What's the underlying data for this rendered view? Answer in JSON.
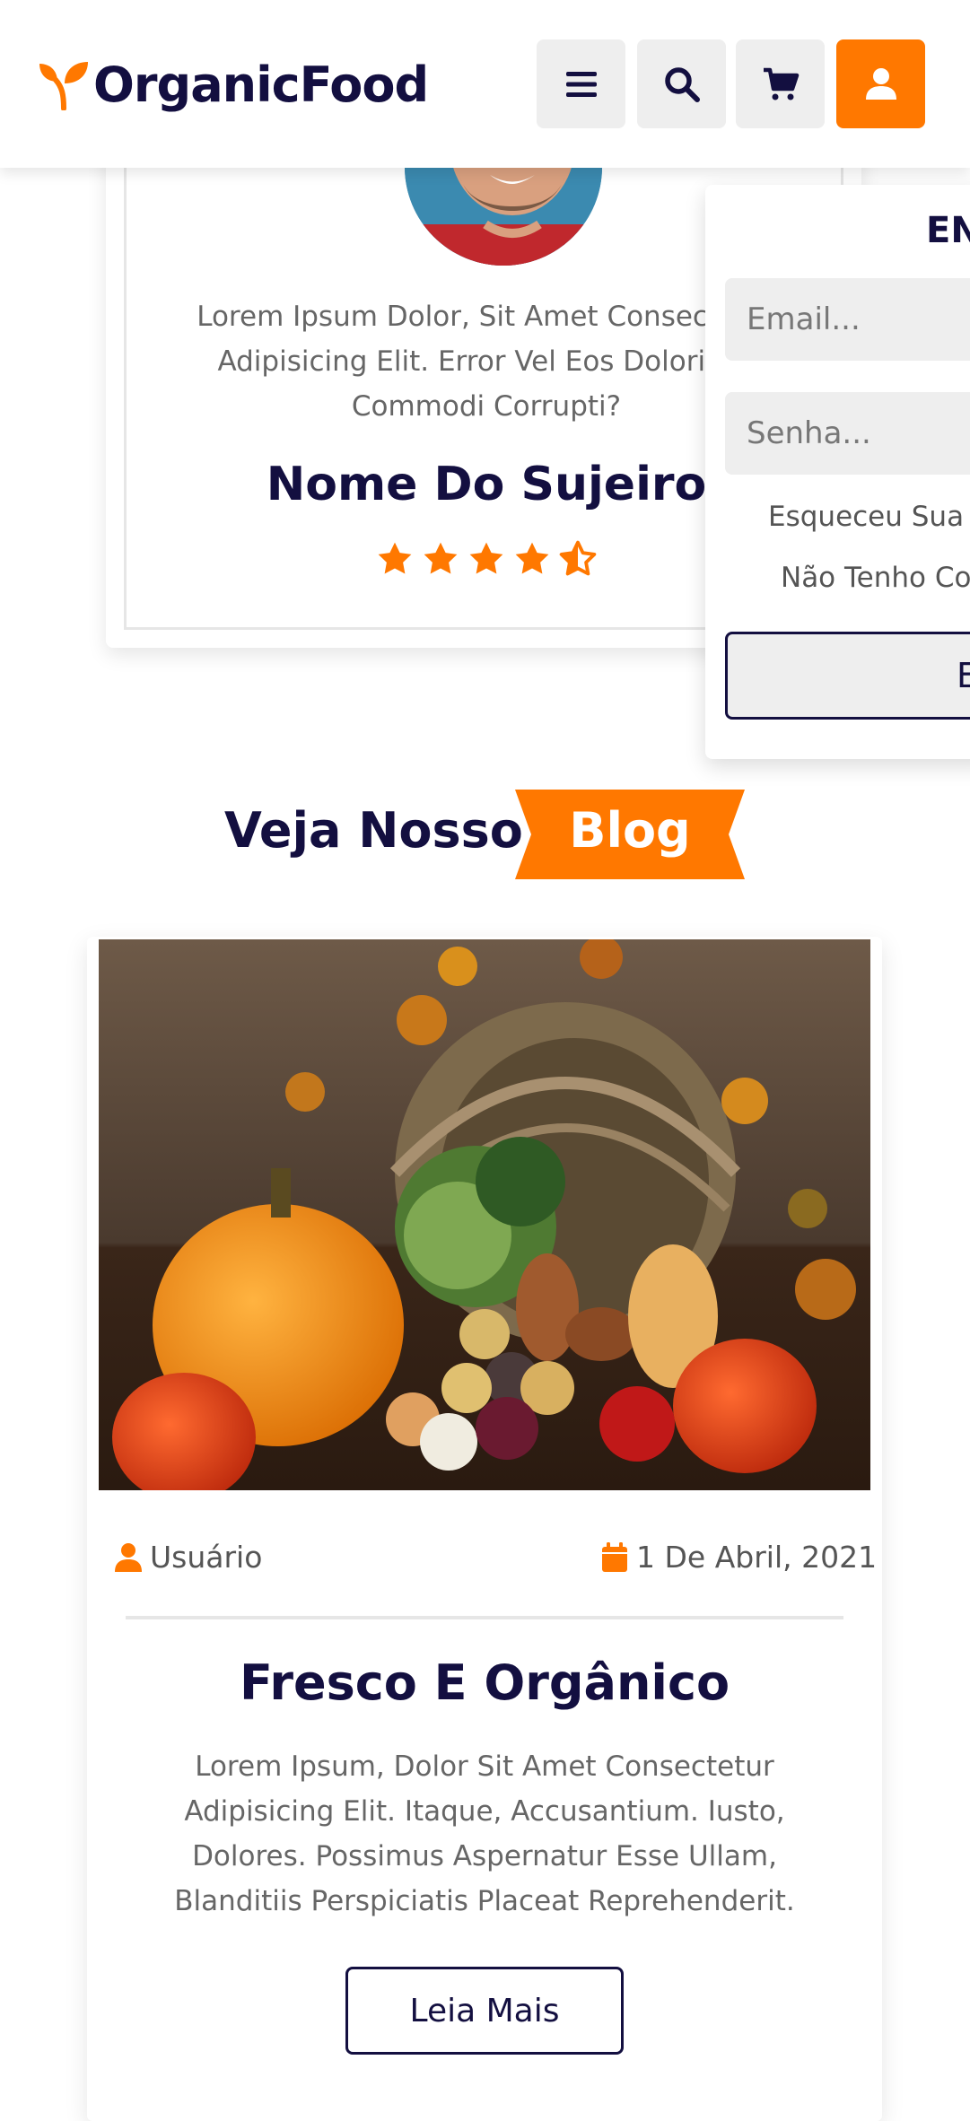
{
  "header": {
    "brand": "OrganicFood",
    "icons": [
      "menu-icon",
      "search-icon",
      "cart-icon",
      "user-icon"
    ],
    "accent": "#ff7800"
  },
  "testimonial": {
    "text": "Lorem Ipsum Dolor, Sit Amet Consectetur\nAdipisicing Elit. Error Vel Eos Doloribus\nCommodi Corrupti?",
    "name": "Nome Do Sujeiro",
    "rating": 4.5
  },
  "login": {
    "title": "ENTRAR",
    "email_placeholder": "Email...",
    "password_placeholder": "Senha...",
    "forgot": "Esqueceu Sua Senha?",
    "register": "Não Tenho Conta?",
    "submit": "Entrar"
  },
  "blog": {
    "heading": "Veja Nosso",
    "ribbon": "Blog",
    "post": {
      "author": "Usuário",
      "date": "1 De Abril, 2021",
      "title": "Fresco E Orgânico",
      "text": "Lorem Ipsum, Dolor Sit Amet Consectetur\nAdipisicing Elit. Itaque, Accusantium. Iusto,\nDolores. Possimus Aspernatur Esse Ullam,\nBlanditiis Perspiciatis Placeat Reprehenderit.",
      "button": "Leia Mais"
    }
  }
}
